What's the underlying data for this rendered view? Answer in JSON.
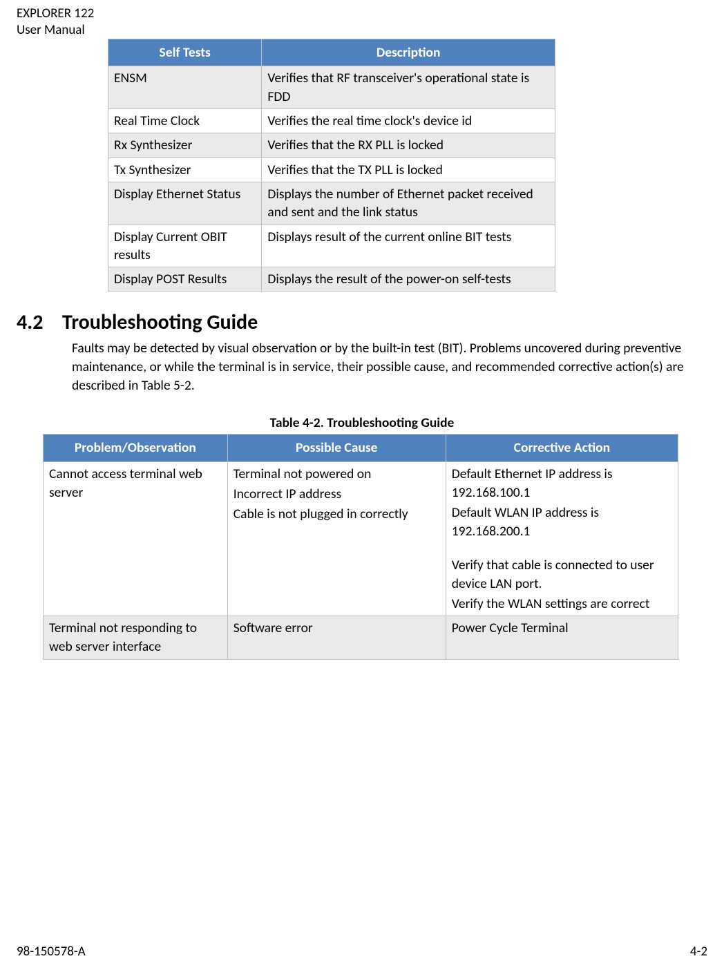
{
  "header": {
    "line1": "EXPLORER 122",
    "line2": "User Manual"
  },
  "table1": {
    "headers": [
      "Self Tests",
      "Description"
    ],
    "rows": [
      {
        "c0": "ENSM",
        "c1": "Verifies that RF transceiver's operational state is FDD",
        "alt": true
      },
      {
        "c0": "Real Time Clock",
        "c1": "Verifies the real time clock's device id",
        "alt": false
      },
      {
        "c0": "Rx Synthesizer",
        "c1": "Verifies that the RX PLL is locked",
        "alt": true
      },
      {
        "c0": "Tx Synthesizer",
        "c1": "Verifies that the TX PLL is locked",
        "alt": false
      },
      {
        "c0": "Display Ethernet Status",
        "c1": "Displays the number of Ethernet packet received and sent and the link status",
        "alt": true
      },
      {
        "c0": "Display Current OBIT results",
        "c1": "Displays result of the current online BIT tests",
        "alt": false
      },
      {
        "c0": "Display POST Results",
        "c1": "Displays the result of the power-on self-tests",
        "alt": true
      }
    ]
  },
  "section": {
    "num": "4.2",
    "title": "Troubleshooting Guide",
    "para": "Faults may be detected by visual observation or by the built-in test (BIT). Problems uncovered during preventive maintenance, or while the terminal is in service, their possible cause, and recommended corrective action(s) are described in Table 5-2."
  },
  "table2": {
    "caption": "Table 4-2.  Troubleshooting Guide",
    "headers": [
      "Problem/Observation",
      "Possible Cause",
      "Corrective Action"
    ],
    "rows": [
      {
        "alt": false,
        "d0": [
          "Cannot access terminal web server"
        ],
        "d1": [
          "Terminal not powered on",
          "Incorrect IP address",
          "Cable is not plugged in correctly"
        ],
        "d2": [
          "Default Ethernet IP address is 192.168.100.1",
          "Default WLAN IP address is 192.168.200.1",
          "",
          "Verify that cable is connected to user device LAN port.",
          "Verify the WLAN settings are correct"
        ]
      },
      {
        "alt": true,
        "d0": [
          "Terminal not responding to web server interface"
        ],
        "d1": [
          "Software error"
        ],
        "d2": [
          "Power Cycle Terminal"
        ]
      }
    ]
  },
  "footer": {
    "left": "98-150578-A",
    "right": "4-2"
  }
}
